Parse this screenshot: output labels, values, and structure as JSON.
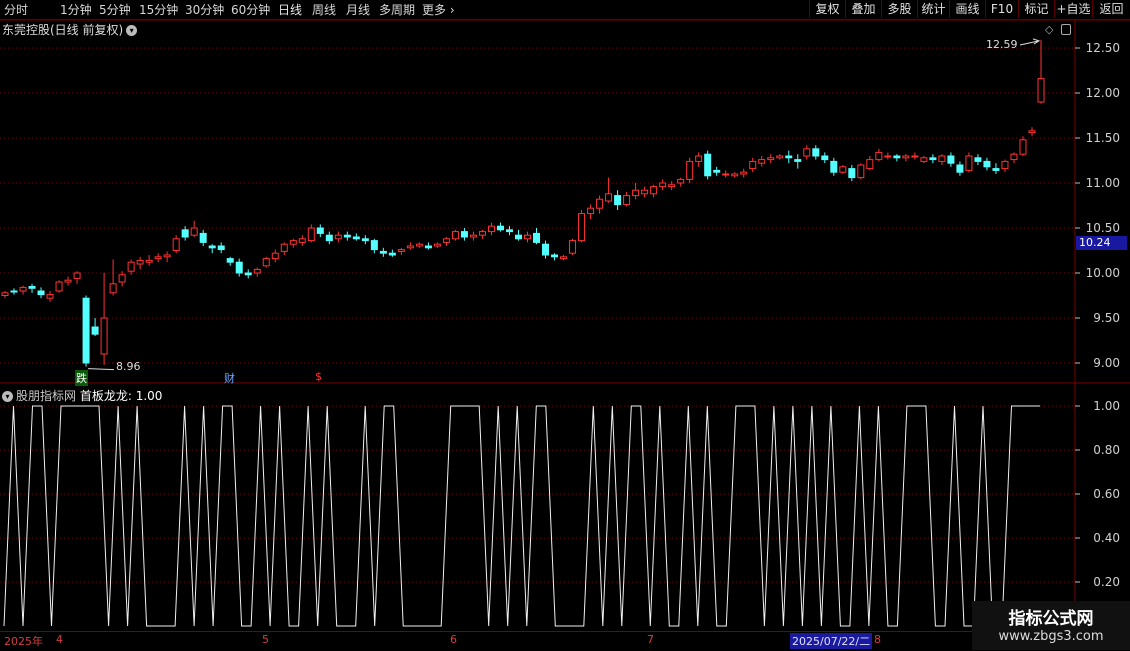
{
  "toolbar": {
    "periods": [
      "分时",
      "1分钟",
      "5分钟",
      "15分钟",
      "30分钟",
      "60分钟",
      "日线",
      "周线",
      "月线",
      "多周期",
      "更多"
    ],
    "active_period": "日线",
    "buttons": [
      "复权",
      "叠加",
      "多股",
      "统计",
      "画线",
      "F10",
      "标记",
      "+自选",
      "返回"
    ]
  },
  "stock": {
    "title": "东莞控股(日线 前复权)"
  },
  "indicator": {
    "source": "股朋指标网",
    "name": "首板龙龙",
    "value": "1.00"
  },
  "price_axis": {
    "labels": [
      "12.50",
      "12.00",
      "11.50",
      "11.00",
      "10.50",
      "10.00",
      "9.50",
      "9.00"
    ],
    "current_price": "10.24"
  },
  "indicator_axis": {
    "labels": [
      "1.00",
      "0.80",
      "0.60",
      "0.40",
      "0.20"
    ]
  },
  "annotations": {
    "high": "12.59",
    "low": "8.96"
  },
  "markers": {
    "die": "跌",
    "cai": "财",
    "dollar": "$"
  },
  "date_axis": {
    "year": "2025年",
    "months": [
      "4",
      "5",
      "6",
      "7",
      "8"
    ],
    "selected_date": "2025/07/22/二"
  },
  "watermark": {
    "title": "指标公式网",
    "url": "www.zbgs3.com"
  },
  "colors": {
    "up": "#ff3232",
    "down": "#54ffff",
    "grid": "#7a0000",
    "bg": "#000000"
  },
  "chart_data": [
    {
      "type": "candlestick",
      "title": "东莞控股(日线 前复权)",
      "ylim": [
        8.9,
        12.7
      ],
      "candles": [
        [
          9.75,
          9.8,
          9.72,
          9.78
        ],
        [
          9.8,
          9.83,
          9.76,
          9.79
        ],
        [
          9.8,
          9.86,
          9.76,
          9.84
        ],
        [
          9.85,
          9.88,
          9.78,
          9.83
        ],
        [
          9.8,
          9.84,
          9.72,
          9.76
        ],
        [
          9.72,
          9.8,
          9.68,
          9.76
        ],
        [
          9.8,
          9.92,
          9.78,
          9.9
        ],
        [
          9.9,
          9.96,
          9.86,
          9.92
        ],
        [
          9.94,
          10.02,
          9.88,
          10.0
        ],
        [
          9.72,
          9.75,
          8.96,
          9.0
        ],
        [
          9.4,
          9.5,
          9.3,
          9.32
        ],
        [
          9.1,
          10.0,
          8.98,
          9.5
        ],
        [
          9.78,
          10.15,
          9.75,
          9.88
        ],
        [
          9.9,
          10.02,
          9.85,
          9.98
        ],
        [
          10.02,
          10.15,
          9.98,
          10.12
        ],
        [
          10.1,
          10.18,
          10.04,
          10.14
        ],
        [
          10.12,
          10.2,
          10.08,
          10.14
        ],
        [
          10.16,
          10.22,
          10.12,
          10.18
        ],
        [
          10.18,
          10.24,
          10.12,
          10.2
        ],
        [
          10.25,
          10.42,
          10.22,
          10.38
        ],
        [
          10.48,
          10.52,
          10.36,
          10.4
        ],
        [
          10.42,
          10.58,
          10.4,
          10.5
        ],
        [
          10.44,
          10.48,
          10.3,
          10.34
        ],
        [
          10.3,
          10.32,
          10.22,
          10.28
        ],
        [
          10.3,
          10.34,
          10.22,
          10.26
        ],
        [
          10.16,
          10.18,
          10.08,
          10.12
        ],
        [
          10.12,
          10.16,
          9.96,
          10.0
        ],
        [
          10.0,
          10.04,
          9.94,
          9.98
        ],
        [
          10.0,
          10.06,
          9.96,
          10.04
        ],
        [
          10.08,
          10.18,
          10.06,
          10.16
        ],
        [
          10.16,
          10.26,
          10.12,
          10.22
        ],
        [
          10.24,
          10.34,
          10.2,
          10.32
        ],
        [
          10.32,
          10.38,
          10.28,
          10.36
        ],
        [
          10.34,
          10.42,
          10.3,
          10.38
        ],
        [
          10.36,
          10.54,
          10.34,
          10.5
        ],
        [
          10.5,
          10.54,
          10.4,
          10.44
        ],
        [
          10.42,
          10.46,
          10.32,
          10.36
        ],
        [
          10.38,
          10.46,
          10.34,
          10.42
        ],
        [
          10.42,
          10.46,
          10.36,
          10.4
        ],
        [
          10.4,
          10.44,
          10.36,
          10.38
        ],
        [
          10.38,
          10.42,
          10.32,
          10.36
        ],
        [
          10.36,
          10.38,
          10.22,
          10.26
        ],
        [
          10.24,
          10.28,
          10.18,
          10.22
        ],
        [
          10.22,
          10.26,
          10.18,
          10.2
        ],
        [
          10.24,
          10.28,
          10.2,
          10.26
        ],
        [
          10.28,
          10.34,
          10.26,
          10.3
        ],
        [
          10.3,
          10.34,
          10.28,
          10.32
        ],
        [
          10.3,
          10.34,
          10.26,
          10.28
        ],
        [
          10.3,
          10.34,
          10.28,
          10.32
        ],
        [
          10.34,
          10.4,
          10.3,
          10.38
        ],
        [
          10.38,
          10.48,
          10.36,
          10.46
        ],
        [
          10.46,
          10.5,
          10.36,
          10.4
        ],
        [
          10.4,
          10.46,
          10.36,
          10.42
        ],
        [
          10.42,
          10.48,
          10.38,
          10.46
        ],
        [
          10.46,
          10.56,
          10.42,
          10.52
        ],
        [
          10.52,
          10.56,
          10.46,
          10.48
        ],
        [
          10.48,
          10.52,
          10.42,
          10.46
        ],
        [
          10.42,
          10.48,
          10.36,
          10.38
        ],
        [
          10.38,
          10.46,
          10.34,
          10.42
        ],
        [
          10.44,
          10.5,
          10.32,
          10.34
        ],
        [
          10.32,
          10.36,
          10.16,
          10.2
        ],
        [
          10.2,
          10.22,
          10.14,
          10.18
        ],
        [
          10.16,
          10.2,
          10.14,
          10.18
        ],
        [
          10.22,
          10.38,
          10.2,
          10.36
        ],
        [
          10.36,
          10.7,
          10.34,
          10.66
        ],
        [
          10.66,
          10.76,
          10.6,
          10.72
        ],
        [
          10.72,
          10.86,
          10.66,
          10.82
        ],
        [
          10.8,
          11.06,
          10.78,
          10.88
        ],
        [
          10.86,
          10.92,
          10.7,
          10.76
        ],
        [
          10.76,
          10.9,
          10.74,
          10.86
        ],
        [
          10.86,
          11.0,
          10.82,
          10.92
        ],
        [
          10.88,
          10.96,
          10.84,
          10.92
        ],
        [
          10.88,
          10.98,
          10.84,
          10.96
        ],
        [
          10.96,
          11.04,
          10.92,
          11.0
        ],
        [
          10.96,
          11.02,
          10.92,
          10.98
        ],
        [
          11.0,
          11.06,
          10.96,
          11.04
        ],
        [
          11.04,
          11.28,
          11.0,
          11.24
        ],
        [
          11.24,
          11.34,
          11.18,
          11.3
        ],
        [
          11.32,
          11.36,
          11.04,
          11.08
        ],
        [
          11.14,
          11.18,
          11.08,
          11.12
        ],
        [
          11.1,
          11.14,
          11.06,
          11.1
        ],
        [
          11.08,
          11.12,
          11.06,
          11.1
        ],
        [
          11.1,
          11.16,
          11.06,
          11.12
        ],
        [
          11.16,
          11.28,
          11.12,
          11.24
        ],
        [
          11.22,
          11.3,
          11.18,
          11.26
        ],
        [
          11.26,
          11.32,
          11.22,
          11.28
        ],
        [
          11.28,
          11.32,
          11.26,
          11.3
        ],
        [
          11.3,
          11.36,
          11.22,
          11.28
        ],
        [
          11.26,
          11.32,
          11.16,
          11.24
        ],
        [
          11.3,
          11.42,
          11.26,
          11.38
        ],
        [
          11.38,
          11.42,
          11.26,
          11.3
        ],
        [
          11.3,
          11.34,
          11.22,
          11.26
        ],
        [
          11.24,
          11.28,
          11.08,
          11.12
        ],
        [
          11.12,
          11.2,
          11.1,
          11.18
        ],
        [
          11.16,
          11.2,
          11.02,
          11.06
        ],
        [
          11.06,
          11.22,
          11.04,
          11.2
        ],
        [
          11.16,
          11.3,
          11.14,
          11.26
        ],
        [
          11.26,
          11.38,
          11.24,
          11.34
        ],
        [
          11.3,
          11.34,
          11.26,
          11.3
        ],
        [
          11.3,
          11.32,
          11.24,
          11.28
        ],
        [
          11.28,
          11.32,
          11.24,
          11.3
        ],
        [
          11.3,
          11.34,
          11.26,
          11.3
        ],
        [
          11.24,
          11.3,
          11.22,
          11.28
        ],
        [
          11.28,
          11.32,
          11.22,
          11.26
        ],
        [
          11.24,
          11.32,
          11.2,
          11.3
        ],
        [
          11.3,
          11.34,
          11.18,
          11.22
        ],
        [
          11.2,
          11.24,
          11.08,
          11.12
        ],
        [
          11.14,
          11.34,
          11.12,
          11.3
        ],
        [
          11.28,
          11.32,
          11.2,
          11.24
        ],
        [
          11.24,
          11.28,
          11.14,
          11.18
        ],
        [
          11.16,
          11.22,
          11.1,
          11.14
        ],
        [
          11.16,
          11.26,
          11.12,
          11.24
        ],
        [
          11.26,
          11.34,
          11.22,
          11.32
        ],
        [
          11.32,
          11.52,
          11.3,
          11.48
        ],
        [
          11.56,
          11.62,
          11.52,
          11.58
        ],
        [
          11.9,
          12.59,
          11.88,
          12.16
        ]
      ]
    },
    {
      "type": "line",
      "title": "首板龙龙",
      "ylim": [
        0,
        1.05
      ],
      "values": [
        0,
        1,
        0,
        1,
        1,
        0,
        1,
        1,
        1,
        1,
        1,
        0,
        1,
        0,
        1,
        0,
        0,
        0,
        0,
        1,
        0,
        1,
        0,
        1,
        1,
        0,
        0,
        1,
        0,
        1,
        0,
        0,
        1,
        0,
        1,
        0,
        0,
        0,
        1,
        0,
        1,
        1,
        0,
        0,
        0,
        0,
        0,
        1,
        1,
        1,
        1,
        0,
        1,
        0,
        1,
        0,
        1,
        1,
        0,
        0,
        0,
        0,
        1,
        0,
        1,
        0,
        1,
        1,
        0,
        1,
        0,
        0,
        1,
        0,
        1,
        0,
        0,
        1,
        1,
        1,
        0,
        1,
        0,
        1,
        0,
        1,
        0,
        1,
        0,
        0,
        1,
        0,
        1,
        0,
        0,
        1,
        1,
        1,
        0,
        0,
        1,
        0,
        0,
        1,
        0,
        0,
        1,
        1,
        1,
        1
      ]
    }
  ]
}
